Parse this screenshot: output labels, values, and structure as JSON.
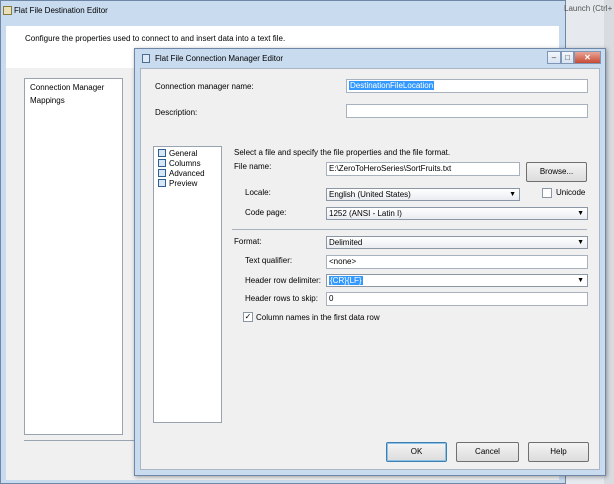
{
  "outer_window": {
    "title": "Flat File Destination Editor",
    "description": "Configure the properties used to connect to and insert data into a text file.",
    "launch_label": "Launch (Ctrl+",
    "nav_items": [
      {
        "label": "Connection Manager"
      },
      {
        "label": "Mappings"
      }
    ]
  },
  "dialog": {
    "title": "Flat File Connection Manager Editor",
    "title_buttons": {
      "minimize": "–",
      "maximize": "□",
      "close": "✕"
    },
    "connection_manager_name_label": "Connection manager name:",
    "connection_manager_name_value": "DestinationFileLocation",
    "description_label": "Description:",
    "description_value": "",
    "nav_items": [
      {
        "label": "General",
        "icon": "general-icon"
      },
      {
        "label": "Columns",
        "icon": "columns-icon"
      },
      {
        "label": "Advanced",
        "icon": "advanced-icon"
      },
      {
        "label": "Preview",
        "icon": "preview-icon"
      }
    ],
    "instructions": "Select a file and specify the file properties and the file format.",
    "file_name_label": "File name:",
    "file_name_value": "E:\\ZeroToHeroSeries\\SortFruits.txt",
    "browse_label": "Browse...",
    "locale_label": "Locale:",
    "locale_value": "English (United States)",
    "unicode_label": "Unicode",
    "unicode_checked": false,
    "code_page_label": "Code page:",
    "code_page_value": "1252  (ANSI - Latin I)",
    "format_label": "Format:",
    "format_value": "Delimited",
    "text_qualifier_label": "Text qualifier:",
    "text_qualifier_value": "<none>",
    "header_row_delimiter_label": "Header row delimiter:",
    "header_row_delimiter_value": "{CR}{LF}",
    "header_rows_to_skip_label": "Header rows to skip:",
    "header_rows_to_skip_value": "0",
    "column_names_label": "Column names in the first data row",
    "column_names_checked": true,
    "buttons": {
      "ok": "OK",
      "cancel": "Cancel",
      "help": "Help"
    }
  }
}
